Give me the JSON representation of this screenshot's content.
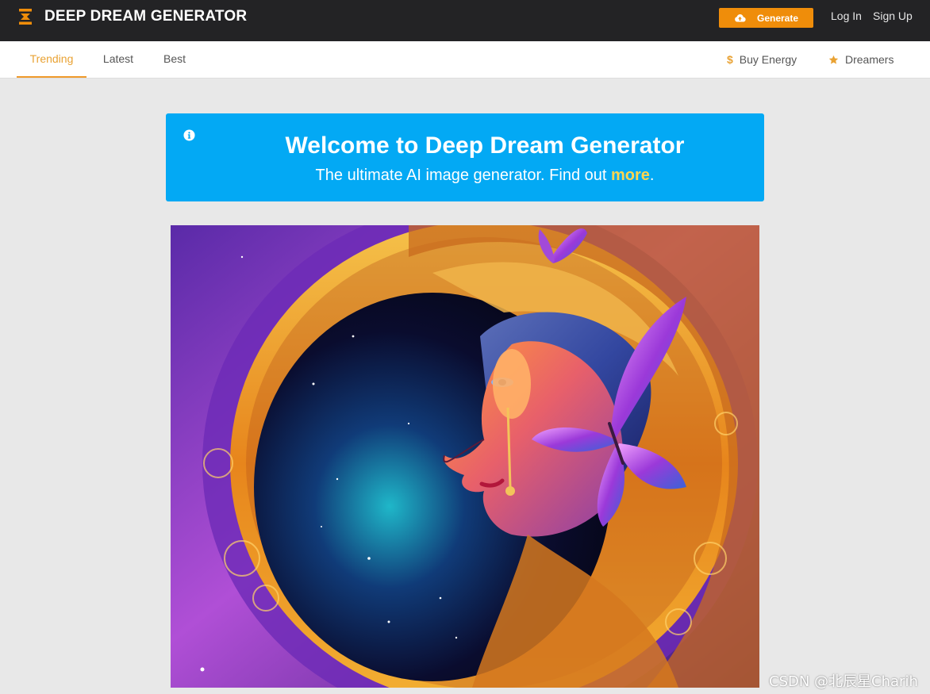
{
  "header": {
    "brand": "DEEP DREAM GENERATOR",
    "brand_icon": "ddg-logo-icon",
    "generate_label": "Generate",
    "generate_icon": "cloud-upload-icon",
    "login_label": "Log In",
    "signup_label": "Sign Up"
  },
  "subnav": {
    "tabs": [
      {
        "label": "Trending",
        "active": true
      },
      {
        "label": "Latest",
        "active": false
      },
      {
        "label": "Best",
        "active": false
      }
    ],
    "buy_energy_icon_text": "$",
    "buy_energy_label": "Buy Energy",
    "dreamers_icon": "star-icon",
    "dreamers_label": "Dreamers"
  },
  "banner": {
    "icon": "info-icon",
    "title": "Welcome to Deep Dream Generator",
    "subtitle_prefix": "The ultimate AI image generator. Find out ",
    "subtitle_link": "more",
    "subtitle_suffix": "."
  },
  "colors": {
    "topbar": "#232325",
    "accent": "#ef8d0a",
    "active_tab": "#e9a233",
    "banner": "#03a9f4",
    "banner_link": "#ffd54f",
    "page_bg": "#e8e8e8"
  },
  "watermark": "CSDN @北辰星Charih"
}
